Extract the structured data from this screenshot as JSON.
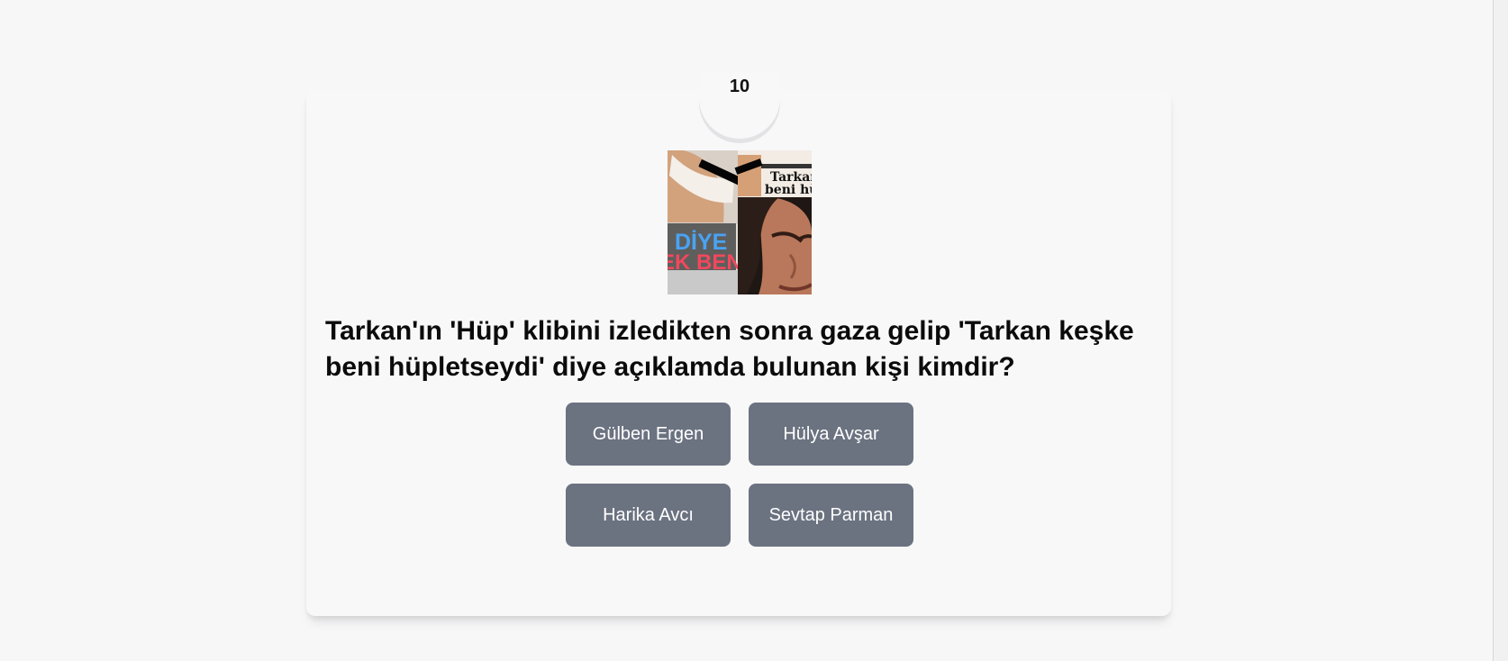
{
  "quiz": {
    "timer": "10",
    "image_alt": "Tarkan and magazine cover collage",
    "image_text": {
      "word_1": "DİYE",
      "word_2": "EK BENİ",
      "headline_1": "Tarkan",
      "headline_2": "beni hüp"
    },
    "question": "Tarkan'ın 'Hüp' klibini izledikten sonra gaza gelip 'Tarkan keşke beni hüpletseydi' diye açıklamda bulunan kişi kimdir?",
    "answers": [
      "Gülben Ergen",
      "Hülya Avşar",
      "Harika Avcı",
      "Sevtap Parman"
    ]
  },
  "colors": {
    "page_background": "#f7f7f8",
    "card_background": "#f8f8f9",
    "answer_button": "#6b7280",
    "answer_text": "#ffffff",
    "question_text": "#0b0b0b"
  }
}
